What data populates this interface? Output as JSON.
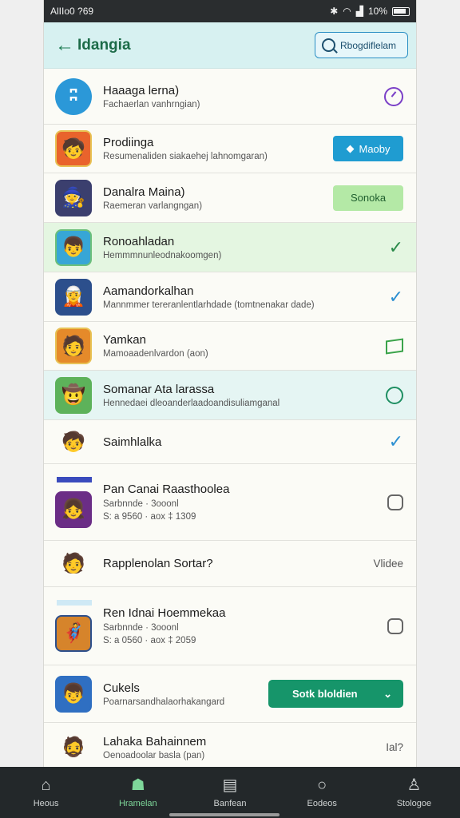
{
  "status_bar": {
    "time": "AlIIo0 ?69",
    "battery": "10%"
  },
  "app_bar": {
    "title": "Idangia",
    "search_label": "Rbogdiflelam"
  },
  "rows": [
    {
      "title": "Haaaga lerna)",
      "subtitle": "Fachaerlan vanhrngian)",
      "action": "clock"
    },
    {
      "title": "Prodiinga",
      "subtitle": "Resumenaliden siakaehej lahnomgaran)",
      "action_label": "Maoby"
    },
    {
      "title": "Danalra Maina)",
      "subtitle": "Raemeran varlangngan)",
      "action_label": "Sonoka"
    },
    {
      "title": "Ronoahladan",
      "subtitle": "Hemmmnunleodnakoomgen)",
      "action": "check"
    },
    {
      "title": "Aamandorkalhan",
      "subtitle": "Mannmmer tereranlentlarhdade (tomtnenakar dade)",
      "action": "check"
    },
    {
      "title": "Yamkan",
      "subtitle": "Mamoaadenlvardon (aon)",
      "action": "flag"
    },
    {
      "title": "Somanar Ata larassa",
      "subtitle": "Hennedaei dleoanderlaadoandisuliamganal",
      "action": "ring"
    },
    {
      "title": "Saimhlalka",
      "action": "check"
    },
    {
      "title": "Pan Canai Raasthoolea",
      "meta1": "Sarbnnde  · 3ooonl",
      "meta2": "S: a 9560 · aox ‡ 1309",
      "action": "box"
    },
    {
      "title": "Rapplenolan Sortar?",
      "action_label": "Vlidee"
    },
    {
      "title": "Ren Idnai Hoemmekaa",
      "meta1": "Sarbnnde  · 3ooonl",
      "meta2": "S: a 0560 · aox ‡ 2059",
      "action": "box"
    },
    {
      "title": "Cukels",
      "subtitle": "Poarnarsandhalaorhakangard",
      "action_label": "Sotk bloldien"
    },
    {
      "title": "Lahaka Bahainnem",
      "subtitle": "Oenoadoolar basla (pan)",
      "action_label": "Ial?"
    }
  ],
  "nav": [
    {
      "label": "Heous",
      "icon": "home-icon"
    },
    {
      "label": "Hramelan",
      "icon": "people-icon"
    },
    {
      "label": "Banfean",
      "icon": "clipboard-icon"
    },
    {
      "label": "Eodeos",
      "icon": "search-icon"
    },
    {
      "label": "Stologoe",
      "icon": "profile-icon"
    }
  ],
  "colors": {
    "accent_green": "#16956a",
    "accent_blue": "#1f9cd1",
    "appbar": "#d7f1f1",
    "navbar": "#23282a"
  }
}
